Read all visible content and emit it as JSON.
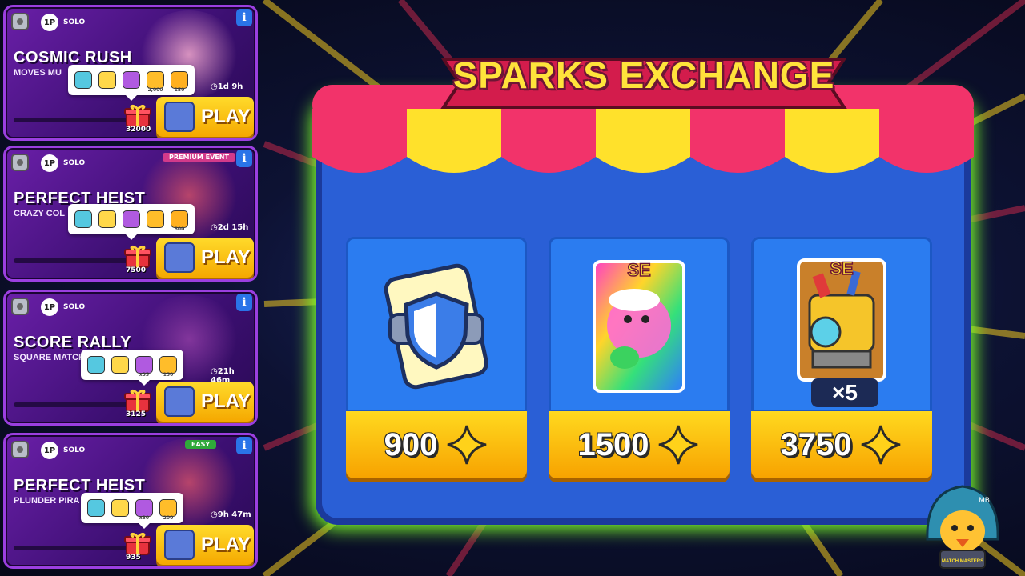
{
  "events": [
    {
      "title": "COSMIC RUSH",
      "subtitle": "MOVES MU",
      "players": "1P",
      "mode": "SOLO",
      "tag": "",
      "timer": "1d 9h",
      "rewards": [
        "",
        "",
        "",
        "2,000",
        "150"
      ],
      "milestone": "32000",
      "play_label": "PLAY",
      "info": "i"
    },
    {
      "title": "PERFECT HEIST",
      "subtitle": "CRAZY COL",
      "players": "1P",
      "mode": "SOLO",
      "tag": "PREMIUM EVENT",
      "timer": "2d 15h",
      "rewards": [
        "",
        "",
        "",
        "",
        "800"
      ],
      "milestone": "7500",
      "play_label": "PLAY",
      "info": "i"
    },
    {
      "title": "SCORE RALLY",
      "subtitle": "SQUARE MATCH",
      "players": "1P",
      "mode": "SOLO",
      "tag": "",
      "timer": "21h 46m",
      "rewards": [
        "",
        "",
        "x35",
        "150"
      ],
      "milestone": "3125",
      "play_label": "PLAY",
      "info": "i"
    },
    {
      "title": "PERFECT HEIST",
      "subtitle": "PLUNDER PIRA",
      "players": "1P",
      "mode": "SOLO",
      "tag": "EASY",
      "timer": "9h 47m",
      "rewards": [
        "",
        "",
        "x30",
        "200"
      ],
      "milestone": "935",
      "play_label": "PLAY",
      "info": "i"
    }
  ],
  "shop": {
    "title": "SPARKS EXCHANGE",
    "offers": [
      {
        "item": "shield-card",
        "price": "900",
        "multiplier": "",
        "badge": ""
      },
      {
        "item": "rainbow-character-card",
        "price": "1500",
        "multiplier": "",
        "badge": "SE"
      },
      {
        "item": "rainbow-train-card",
        "price": "3750",
        "multiplier": "×5",
        "badge": "SE"
      }
    ]
  },
  "avatar": {
    "badge": "MATCH MASTERS",
    "initials": "MB"
  },
  "colors": {
    "glow": "#7cff2a",
    "panel": "#2a5fd6",
    "price": "#f7b800",
    "awning_red": "#f2336a",
    "awning_yellow": "#ffe12b",
    "event_purple": "#6a1fa8"
  }
}
